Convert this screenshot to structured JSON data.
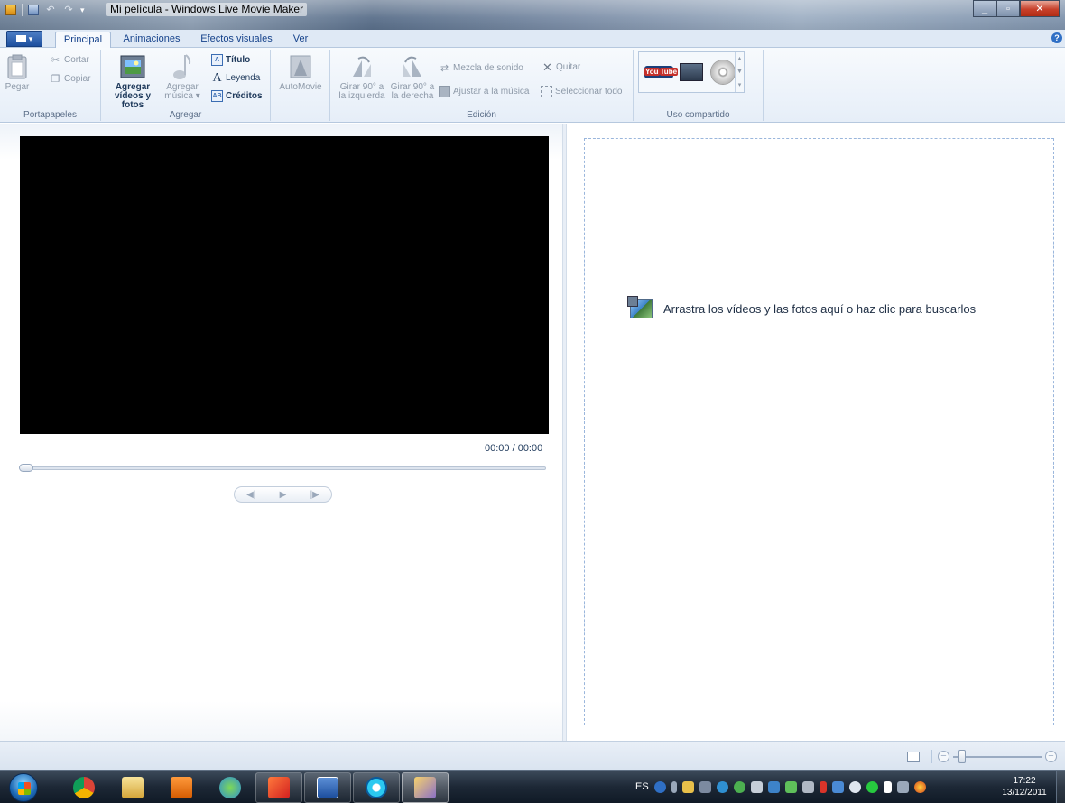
{
  "window": {
    "title": "Mi película - Windows Live Movie Maker"
  },
  "tabs": [
    {
      "label": "Principal",
      "active": true
    },
    {
      "label": "Animaciones"
    },
    {
      "label": "Efectos visuales"
    },
    {
      "label": "Ver"
    }
  ],
  "ribbon": {
    "clipboard": {
      "group_label": "Portapapeles",
      "paste": "Pegar",
      "cut": "Cortar",
      "copy": "Copiar"
    },
    "add": {
      "group_label": "Agregar",
      "add_videos_line1": "Agregar",
      "add_videos_line2": "vídeos y fotos",
      "add_music_line1": "Agregar",
      "add_music_line2": "música",
      "title": "Título",
      "caption": "Leyenda",
      "credits": "Créditos"
    },
    "automovie": "AutoMovie",
    "editing": {
      "group_label": "Edición",
      "rotate_left_line1": "Girar 90° a",
      "rotate_left_line2": "la izquierda",
      "rotate_right_line1": "Girar 90° a",
      "rotate_right_line2": "la derecha",
      "audio_mix": "Mezcla de sonido",
      "remove": "Quitar",
      "fit_to_music": "Ajustar a la música",
      "select_all": "Seleccionar todo"
    },
    "sharing": {
      "group_label": "Uso compartido",
      "youtube_label": "You",
      "youtube_label2": "Tube"
    }
  },
  "preview": {
    "timecode": "00:00 / 00:00",
    "seek_fraction": 0
  },
  "storyboard": {
    "hint": "Arrastra los vídeos y las fotos aquí o haz clic para buscarlos"
  },
  "statusbar": {
    "zoom_minus": "−",
    "zoom_plus": "+"
  },
  "taskbar": {
    "language": "ES",
    "time": "17:22",
    "date": "13/12/2011"
  },
  "colors": {
    "ribbon_text": "#1e395b",
    "storyboard_border": "#9ab6dc",
    "video_bg": "#000000"
  }
}
